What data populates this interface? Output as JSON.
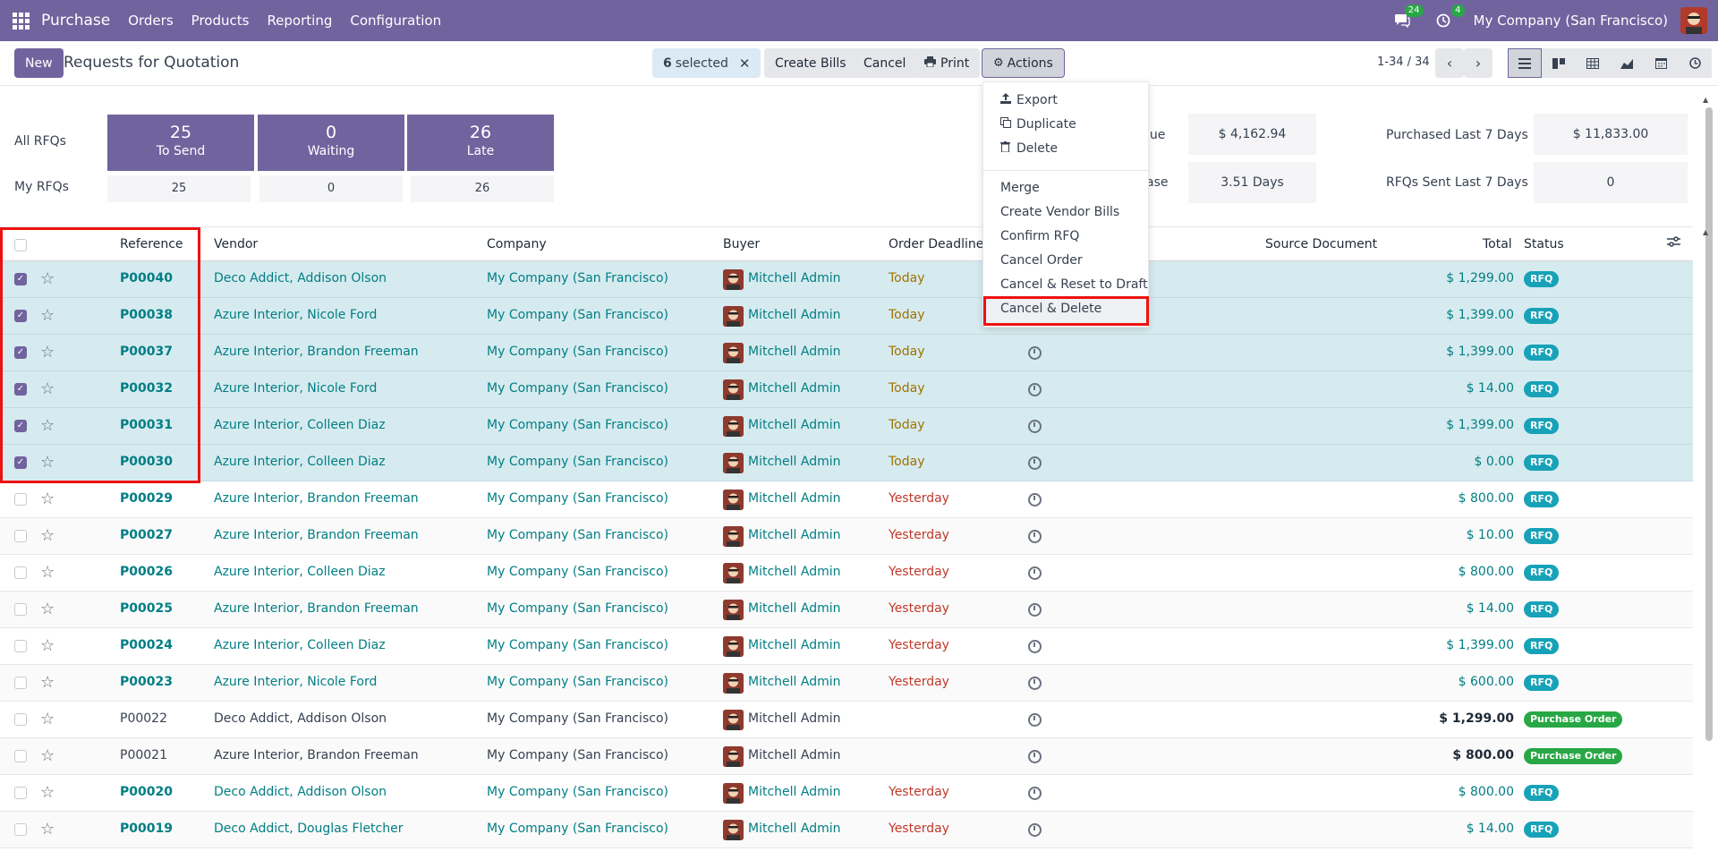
{
  "navbar": {
    "brand": "Purchase",
    "menu": [
      "Orders",
      "Products",
      "Reporting",
      "Configuration"
    ],
    "chat_badge": "24",
    "activity_badge": "4",
    "company": "My Company (San Francisco)"
  },
  "control_panel": {
    "new_label": "New",
    "title": "Requests for Quotation",
    "selected_count": "6",
    "selected_label": "selected",
    "create_bills": "Create Bills",
    "cancel": "Cancel",
    "print": "Print",
    "actions": "Actions",
    "pager": "1-34 / 34"
  },
  "dashboard": {
    "all_rfqs": "All RFQs",
    "my_rfqs": "My RFQs",
    "tiles": [
      {
        "num": "25",
        "label": "To Send",
        "mine": "25"
      },
      {
        "num": "0",
        "label": "Waiting",
        "mine": "0"
      },
      {
        "num": "26",
        "label": "Late",
        "mine": "26"
      }
    ],
    "kpi_partial_1": "lue",
    "kpi_val_1": "$ 4,162.94",
    "kpi_partial_2": "ase",
    "kpi_val_2": "3.51 Days",
    "kpi_lbl_3": "Purchased Last 7 Days",
    "kpi_val_3": "$ 11,833.00",
    "kpi_lbl_4": "RFQs Sent Last 7 Days",
    "kpi_val_4": "0"
  },
  "actions_menu": {
    "export": "Export",
    "duplicate": "Duplicate",
    "delete": "Delete",
    "merge": "Merge",
    "create_vendor_bills": "Create Vendor Bills",
    "confirm_rfq": "Confirm RFQ",
    "cancel_order": "Cancel Order",
    "cancel_reset": "Cancel & Reset to Draft",
    "cancel_delete": "Cancel & Delete"
  },
  "table": {
    "headers": {
      "reference": "Reference",
      "vendor": "Vendor",
      "company": "Company",
      "buyer": "Buyer",
      "deadline": "Order Deadline",
      "source": "Source Document",
      "total": "Total",
      "status": "Status"
    },
    "rows": [
      {
        "ref": "P00040",
        "vendor": "Deco Addict, Addison Olson",
        "company": "My Company (San Francisco)",
        "buyer": "Mitchell Admin",
        "deadline": "Today",
        "total": "$ 1,299.00",
        "status": "RFQ"
      },
      {
        "ref": "P00038",
        "vendor": "Azure Interior, Nicole Ford",
        "company": "My Company (San Francisco)",
        "buyer": "Mitchell Admin",
        "deadline": "Today",
        "total": "$ 1,399.00",
        "status": "RFQ"
      },
      {
        "ref": "P00037",
        "vendor": "Azure Interior, Brandon Freeman",
        "company": "My Company (San Francisco)",
        "buyer": "Mitchell Admin",
        "deadline": "Today",
        "total": "$ 1,399.00",
        "status": "RFQ"
      },
      {
        "ref": "P00032",
        "vendor": "Azure Interior, Nicole Ford",
        "company": "My Company (San Francisco)",
        "buyer": "Mitchell Admin",
        "deadline": "Today",
        "total": "$ 14.00",
        "status": "RFQ"
      },
      {
        "ref": "P00031",
        "vendor": "Azure Interior, Colleen Diaz",
        "company": "My Company (San Francisco)",
        "buyer": "Mitchell Admin",
        "deadline": "Today",
        "total": "$ 1,399.00",
        "status": "RFQ"
      },
      {
        "ref": "P00030",
        "vendor": "Azure Interior, Colleen Diaz",
        "company": "My Company (San Francisco)",
        "buyer": "Mitchell Admin",
        "deadline": "Today",
        "total": "$ 0.00",
        "status": "RFQ"
      },
      {
        "ref": "P00029",
        "vendor": "Azure Interior, Brandon Freeman",
        "company": "My Company (San Francisco)",
        "buyer": "Mitchell Admin",
        "deadline": "Yesterday",
        "total": "$ 800.00",
        "status": "RFQ"
      },
      {
        "ref": "P00027",
        "vendor": "Azure Interior, Brandon Freeman",
        "company": "My Company (San Francisco)",
        "buyer": "Mitchell Admin",
        "deadline": "Yesterday",
        "total": "$ 10.00",
        "status": "RFQ"
      },
      {
        "ref": "P00026",
        "vendor": "Azure Interior, Colleen Diaz",
        "company": "My Company (San Francisco)",
        "buyer": "Mitchell Admin",
        "deadline": "Yesterday",
        "total": "$ 800.00",
        "status": "RFQ"
      },
      {
        "ref": "P00025",
        "vendor": "Azure Interior, Brandon Freeman",
        "company": "My Company (San Francisco)",
        "buyer": "Mitchell Admin",
        "deadline": "Yesterday",
        "total": "$ 14.00",
        "status": "RFQ"
      },
      {
        "ref": "P00024",
        "vendor": "Azure Interior, Colleen Diaz",
        "company": "My Company (San Francisco)",
        "buyer": "Mitchell Admin",
        "deadline": "Yesterday",
        "total": "$ 1,399.00",
        "status": "RFQ"
      },
      {
        "ref": "P00023",
        "vendor": "Azure Interior, Nicole Ford",
        "company": "My Company (San Francisco)",
        "buyer": "Mitchell Admin",
        "deadline": "Yesterday",
        "total": "$ 600.00",
        "status": "RFQ"
      },
      {
        "ref": "P00022",
        "vendor": "Deco Addict, Addison Olson",
        "company": "My Company (San Francisco)",
        "buyer": "Mitchell Admin",
        "deadline": "",
        "total": "$ 1,299.00",
        "status": "Purchase Order"
      },
      {
        "ref": "P00021",
        "vendor": "Azure Interior, Brandon Freeman",
        "company": "My Company (San Francisco)",
        "buyer": "Mitchell Admin",
        "deadline": "",
        "total": "$ 800.00",
        "status": "Purchase Order"
      },
      {
        "ref": "P00020",
        "vendor": "Deco Addict, Addison Olson",
        "company": "My Company (San Francisco)",
        "buyer": "Mitchell Admin",
        "deadline": "Yesterday",
        "total": "$ 800.00",
        "status": "RFQ"
      },
      {
        "ref": "P00019",
        "vendor": "Deco Addict, Douglas Fletcher",
        "company": "My Company (San Francisco)",
        "buyer": "Mitchell Admin",
        "deadline": "Yesterday",
        "total": "$ 14.00",
        "status": "RFQ"
      }
    ]
  },
  "colors": {
    "brand": "#71639e",
    "link": "#017e84",
    "today": "#a07200",
    "yesterday": "#c0392b",
    "rfq_badge": "#17a2b8",
    "po_badge": "#28a745",
    "highlight": "#e11111"
  }
}
